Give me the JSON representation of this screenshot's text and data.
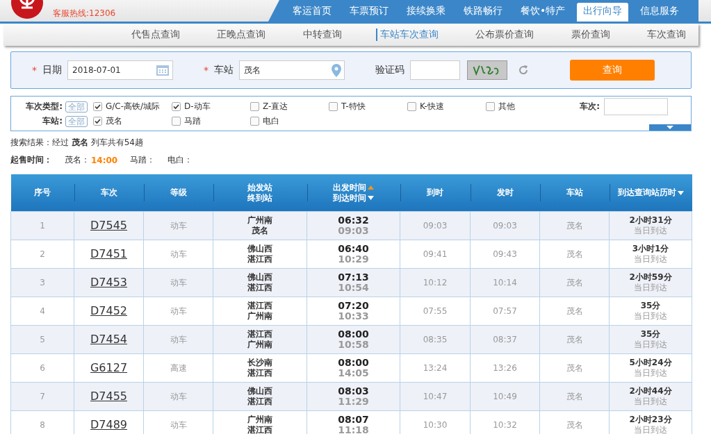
{
  "header": {
    "hotline": "客服热线:12306"
  },
  "nav": [
    {
      "label": "客运首页",
      "selected": false
    },
    {
      "label": "车票预订",
      "selected": false
    },
    {
      "label": "接续换乘",
      "selected": false
    },
    {
      "label": "铁路畅行",
      "selected": false
    },
    {
      "label": "餐饮•特产",
      "selected": false
    },
    {
      "label": "出行向导",
      "selected": true
    },
    {
      "label": "信息服务",
      "selected": false
    }
  ],
  "subnav": [
    {
      "label": "代售点查询",
      "selected": false
    },
    {
      "label": "正晚点查询",
      "selected": false
    },
    {
      "label": "中转查询",
      "selected": false
    },
    {
      "label": "车站车次查询",
      "selected": true
    },
    {
      "label": "公布票价查询",
      "selected": false
    },
    {
      "label": "票价查询",
      "selected": false
    },
    {
      "label": "车次查询",
      "selected": false
    }
  ],
  "query": {
    "required_mark": "*",
    "date_label": "日期",
    "date_value": "2018-07-01",
    "station_label": "车站",
    "station_value": "茂名",
    "captcha_label": "验证码",
    "search_button": "查询"
  },
  "filters": {
    "type_label": "车次类型:",
    "type_all": "全部",
    "types": [
      {
        "label": "G/C-高铁/城际",
        "checked": true
      },
      {
        "label": "D-动车",
        "checked": true
      },
      {
        "label": "Z-直达",
        "checked": false
      },
      {
        "label": "T-特快",
        "checked": false
      },
      {
        "label": "K-快速",
        "checked": false
      },
      {
        "label": "其他",
        "checked": false
      }
    ],
    "station_label": "车站:",
    "station_all": "全部",
    "stations": [
      {
        "label": "茂名",
        "checked": true
      },
      {
        "label": "马踏",
        "checked": false
      },
      {
        "label": "电白",
        "checked": false
      }
    ],
    "train_no_label": "车次:"
  },
  "result": "搜索结果：经过 **茂名** 列车共有54趟",
  "sale_times": {
    "label": "起售时间：",
    "items": [
      {
        "station": "茂名：",
        "time": "14:00"
      },
      {
        "station": "马踏："
      },
      {
        "station": "电白："
      }
    ]
  },
  "table": {
    "columns": [
      {
        "label": "序号"
      },
      {
        "label": "车次"
      },
      {
        "label": "等级"
      },
      {
        "label": "始发站",
        "label2": "终到站"
      },
      {
        "label": "出发时间",
        "sort_up": true,
        "label2": "到达时间",
        "sort_down2": true
      },
      {
        "label": "到时"
      },
      {
        "label": "发时"
      },
      {
        "label": "车站"
      },
      {
        "label": "到达查询站历时",
        "sort_down": true
      }
    ],
    "rows": [
      {
        "no": "1",
        "train": "D7545",
        "grade": "动车",
        "from": "广州南",
        "to": "茂名",
        "dep": "06:32",
        "arr": "09:03",
        "arr_here": "09:03",
        "dep_here": "09:03",
        "station": "茂名",
        "duration": "2小时31分",
        "note": "当日到达"
      },
      {
        "no": "2",
        "train": "D7451",
        "grade": "动车",
        "from": "佛山西",
        "to": "湛江西",
        "dep": "06:40",
        "arr": "10:29",
        "arr_here": "09:41",
        "dep_here": "09:43",
        "station": "茂名",
        "duration": "3小时1分",
        "note": "当日到达"
      },
      {
        "no": "3",
        "train": "D7453",
        "grade": "动车",
        "from": "佛山西",
        "to": "湛江西",
        "dep": "07:13",
        "arr": "10:54",
        "arr_here": "10:12",
        "dep_here": "10:14",
        "station": "茂名",
        "duration": "2小时59分",
        "note": "当日到达"
      },
      {
        "no": "4",
        "train": "D7452",
        "grade": "动车",
        "from": "湛江西",
        "to": "广州南",
        "dep": "07:20",
        "arr": "10:33",
        "arr_here": "07:55",
        "dep_here": "07:57",
        "station": "茂名",
        "duration": "35分",
        "note": "当日到达"
      },
      {
        "no": "5",
        "train": "D7454",
        "grade": "动车",
        "from": "湛江西",
        "to": "广州南",
        "dep": "08:00",
        "arr": "10:58",
        "arr_here": "08:35",
        "dep_here": "08:37",
        "station": "茂名",
        "duration": "35分",
        "note": "当日到达"
      },
      {
        "no": "6",
        "train": "G6127",
        "grade": "高速",
        "from": "长沙南",
        "to": "湛江西",
        "dep": "08:00",
        "arr": "14:05",
        "arr_here": "13:24",
        "dep_here": "13:26",
        "station": "茂名",
        "duration": "5小时24分",
        "note": "当日到达"
      },
      {
        "no": "7",
        "train": "D7455",
        "grade": "动车",
        "from": "佛山西",
        "to": "湛江西",
        "dep": "08:03",
        "arr": "11:29",
        "arr_here": "10:47",
        "dep_here": "10:49",
        "station": "茂名",
        "duration": "2小时44分",
        "note": "当日到达"
      },
      {
        "no": "8",
        "train": "D7489",
        "grade": "动车",
        "from": "广州南",
        "to": "湛江西",
        "dep": "08:07",
        "arr": "11:18",
        "arr_here": "10:30",
        "dep_here": "10:32",
        "station": "茂名",
        "duration": "2小时23分",
        "note": "当日到达"
      }
    ]
  }
}
